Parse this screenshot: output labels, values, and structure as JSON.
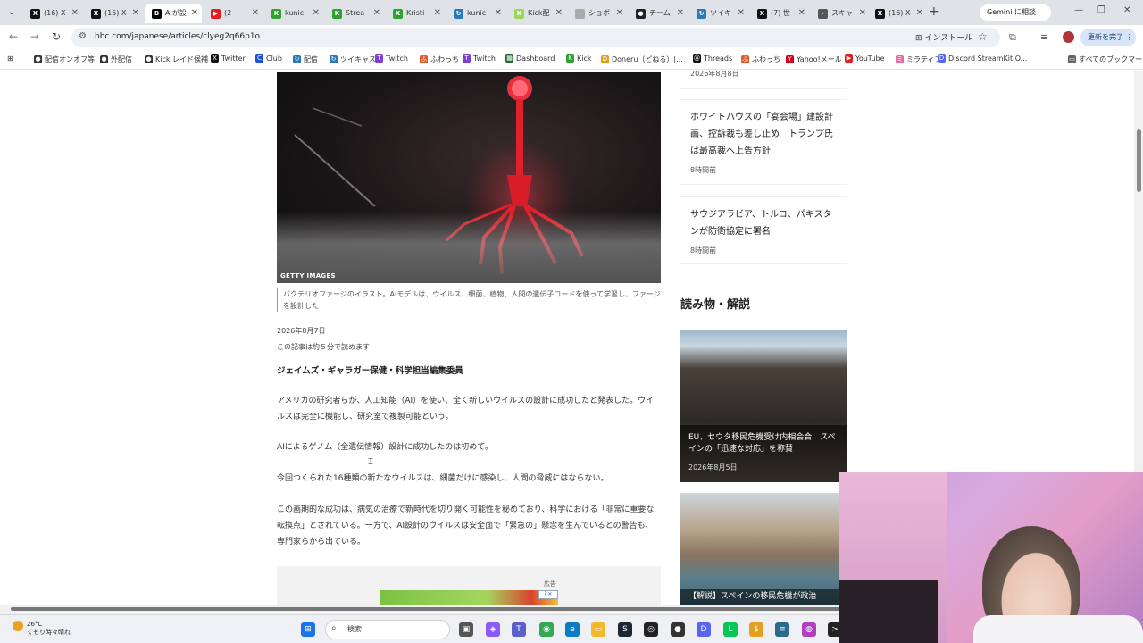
{
  "browser": {
    "tabs": [
      {
        "label": "(16) X",
        "icon": "x-icon"
      },
      {
        "label": "(15) X",
        "icon": "x-icon"
      },
      {
        "label": "AIが設",
        "icon": "bbc-icon",
        "active": true
      },
      {
        "label": "(2",
        "icon": "youtube-icon"
      },
      {
        "label": "kunic",
        "icon": "kick-icon"
      },
      {
        "label": "Strea",
        "icon": "kick-icon"
      },
      {
        "label": "Kristi",
        "icon": "kick-icon"
      },
      {
        "label": "kunic",
        "icon": "refresh-icon"
      },
      {
        "label": "Kick配",
        "icon": "kick-icon"
      },
      {
        "label": "ショボ",
        "icon": "generic-icon"
      },
      {
        "label": "チーム",
        "icon": "globe-icon"
      },
      {
        "label": "ツイキ",
        "icon": "refresh-icon"
      },
      {
        "label": "(7) 世",
        "icon": "x-icon"
      },
      {
        "label": "スキャ",
        "icon": "generic-icon"
      },
      {
        "label": "(16) X",
        "icon": "x-icon"
      }
    ],
    "gemini_label": "Gemini に相談",
    "url": "bbc.com/japanese/articles/clyeg2q66p1o",
    "install_label": "インストール",
    "update_label": "更新を完了",
    "bookmarks": [
      {
        "label": "配信オンオフ等",
        "icon": "globe-icon"
      },
      {
        "label": "外配信",
        "icon": "globe-icon"
      },
      {
        "label": "Kick レイド候補",
        "icon": "globe-icon"
      },
      {
        "label": "Twitter",
        "icon": "x-icon"
      },
      {
        "label": "Club",
        "icon": "club-icon"
      },
      {
        "label": "配信",
        "icon": "refresh-icon"
      },
      {
        "label": "ツイキャス",
        "icon": "refresh-icon"
      },
      {
        "label": "Twitch",
        "icon": "twitch-icon"
      },
      {
        "label": "ふわっち",
        "icon": "fuwatch-icon"
      },
      {
        "label": "Twitch",
        "icon": "twitch-icon"
      },
      {
        "label": "Dashboard",
        "icon": "dashboard-icon"
      },
      {
        "label": "Kick",
        "icon": "kick-icon"
      },
      {
        "label": "Doneru（どねる）|...",
        "icon": "doneru-icon"
      },
      {
        "label": "Threads",
        "icon": "threads-icon"
      },
      {
        "label": "ふわっち",
        "icon": "fuwatch-icon"
      },
      {
        "label": "Yahoo!メール",
        "icon": "yahoo-icon"
      },
      {
        "label": "YouTube",
        "icon": "youtube-icon"
      },
      {
        "label": "ミラティブ",
        "icon": "mirrativ-icon"
      },
      {
        "label": "Discord StreamKit O...",
        "icon": "discord-icon"
      },
      {
        "label": "すべてのブックマーク",
        "icon": "folder-icon"
      }
    ]
  },
  "article": {
    "image_credit": "GETTY IMAGES",
    "caption": "バクテリオファージのイラスト。AIモデルは、ウイルス、細菌、植物、人間の遺伝子コードを使って学習し、ファージを設計した",
    "date": "2026年8月7日",
    "read_time": "この記事は約５分で読めます",
    "byline": "ジェイムズ・ギャラガー保健・科学担当編集委員",
    "paragraphs": [
      "アメリカの研究者らが、人工知能（AI）を使い、全く新しいウイルスの設計に成功したと発表した。ウイルスは完全に機能し、研究室で複製可能という。",
      "AIによるゲノム（全遺伝情報）設計に成功したのは初めて。",
      "今回つくられた16種類の新たなウイルスは、細菌だけに感染し、人間の脅威にはならない。",
      "この画期的な成功は、病気の治療で新時代を切り開く可能性を秘めており、科学における「非常に重要な転換点」とされている。一方で、AI設計のウイルスは安全面で「緊急の」懸念を生んでいるとの警告も、専門家らから出ている。"
    ],
    "ad_label": "広告"
  },
  "sidebar": {
    "stub_date": "2026年8月8日",
    "news": [
      {
        "title": "ホワイトハウスの「宴会場」建設計画、控訴裁も差し止め　トランプ氏は最高裁へ上告方針",
        "time": "8時間前"
      },
      {
        "title": "サウジアラビア、トルコ、パキスタンが防衛協定に署名",
        "time": "8時間前"
      }
    ],
    "section_title": "読み物・解説",
    "features": [
      {
        "title": "EU、セウタ移民危機受け内相会合　スペインの「迅速な対応」を称賛",
        "date": "2026年8月5日"
      },
      {
        "title": "【解説】スペインの移民危機が政治"
      }
    ]
  },
  "taskbar": {
    "temperature": "26°C",
    "weather": "くもり時々晴れ",
    "search_placeholder": "検索",
    "apps": [
      "start-icon",
      "task-view-icon",
      "copilot-icon",
      "teams-icon",
      "chrome-icon",
      "edge-icon",
      "explorer-icon",
      "steam-icon",
      "obs-icon",
      "app-icon",
      "discord-icon",
      "line-icon",
      "coin-icon",
      "notepad-icon",
      "app2-icon",
      "terminal-icon"
    ]
  },
  "colors": {
    "active_tab": "#ffffff",
    "tabstrip": "#dfe3e7",
    "page_bg": "#ffffff",
    "hero_accent": "#e0202a"
  }
}
